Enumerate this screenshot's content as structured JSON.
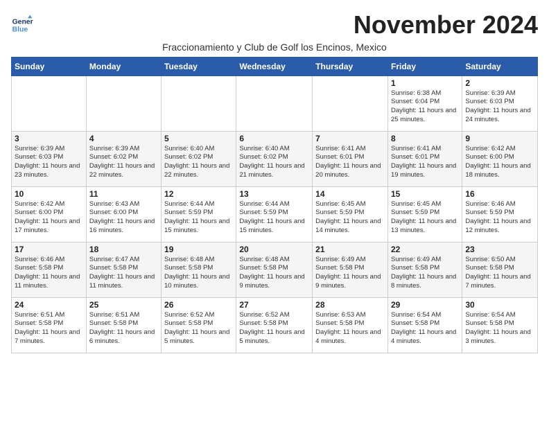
{
  "logo": {
    "line1": "General",
    "line2": "Blue"
  },
  "title": "November 2024",
  "subtitle": "Fraccionamiento y Club de Golf los Encinos, Mexico",
  "days_header": [
    "Sunday",
    "Monday",
    "Tuesday",
    "Wednesday",
    "Thursday",
    "Friday",
    "Saturday"
  ],
  "weeks": [
    [
      {
        "num": "",
        "info": ""
      },
      {
        "num": "",
        "info": ""
      },
      {
        "num": "",
        "info": ""
      },
      {
        "num": "",
        "info": ""
      },
      {
        "num": "",
        "info": ""
      },
      {
        "num": "1",
        "info": "Sunrise: 6:38 AM\nSunset: 6:04 PM\nDaylight: 11 hours and 25 minutes."
      },
      {
        "num": "2",
        "info": "Sunrise: 6:39 AM\nSunset: 6:03 PM\nDaylight: 11 hours and 24 minutes."
      }
    ],
    [
      {
        "num": "3",
        "info": "Sunrise: 6:39 AM\nSunset: 6:03 PM\nDaylight: 11 hours and 23 minutes."
      },
      {
        "num": "4",
        "info": "Sunrise: 6:39 AM\nSunset: 6:02 PM\nDaylight: 11 hours and 22 minutes."
      },
      {
        "num": "5",
        "info": "Sunrise: 6:40 AM\nSunset: 6:02 PM\nDaylight: 11 hours and 22 minutes."
      },
      {
        "num": "6",
        "info": "Sunrise: 6:40 AM\nSunset: 6:02 PM\nDaylight: 11 hours and 21 minutes."
      },
      {
        "num": "7",
        "info": "Sunrise: 6:41 AM\nSunset: 6:01 PM\nDaylight: 11 hours and 20 minutes."
      },
      {
        "num": "8",
        "info": "Sunrise: 6:41 AM\nSunset: 6:01 PM\nDaylight: 11 hours and 19 minutes."
      },
      {
        "num": "9",
        "info": "Sunrise: 6:42 AM\nSunset: 6:00 PM\nDaylight: 11 hours and 18 minutes."
      }
    ],
    [
      {
        "num": "10",
        "info": "Sunrise: 6:42 AM\nSunset: 6:00 PM\nDaylight: 11 hours and 17 minutes."
      },
      {
        "num": "11",
        "info": "Sunrise: 6:43 AM\nSunset: 6:00 PM\nDaylight: 11 hours and 16 minutes."
      },
      {
        "num": "12",
        "info": "Sunrise: 6:44 AM\nSunset: 5:59 PM\nDaylight: 11 hours and 15 minutes."
      },
      {
        "num": "13",
        "info": "Sunrise: 6:44 AM\nSunset: 5:59 PM\nDaylight: 11 hours and 15 minutes."
      },
      {
        "num": "14",
        "info": "Sunrise: 6:45 AM\nSunset: 5:59 PM\nDaylight: 11 hours and 14 minutes."
      },
      {
        "num": "15",
        "info": "Sunrise: 6:45 AM\nSunset: 5:59 PM\nDaylight: 11 hours and 13 minutes."
      },
      {
        "num": "16",
        "info": "Sunrise: 6:46 AM\nSunset: 5:59 PM\nDaylight: 11 hours and 12 minutes."
      }
    ],
    [
      {
        "num": "17",
        "info": "Sunrise: 6:46 AM\nSunset: 5:58 PM\nDaylight: 11 hours and 11 minutes."
      },
      {
        "num": "18",
        "info": "Sunrise: 6:47 AM\nSunset: 5:58 PM\nDaylight: 11 hours and 11 minutes."
      },
      {
        "num": "19",
        "info": "Sunrise: 6:48 AM\nSunset: 5:58 PM\nDaylight: 11 hours and 10 minutes."
      },
      {
        "num": "20",
        "info": "Sunrise: 6:48 AM\nSunset: 5:58 PM\nDaylight: 11 hours and 9 minutes."
      },
      {
        "num": "21",
        "info": "Sunrise: 6:49 AM\nSunset: 5:58 PM\nDaylight: 11 hours and 9 minutes."
      },
      {
        "num": "22",
        "info": "Sunrise: 6:49 AM\nSunset: 5:58 PM\nDaylight: 11 hours and 8 minutes."
      },
      {
        "num": "23",
        "info": "Sunrise: 6:50 AM\nSunset: 5:58 PM\nDaylight: 11 hours and 7 minutes."
      }
    ],
    [
      {
        "num": "24",
        "info": "Sunrise: 6:51 AM\nSunset: 5:58 PM\nDaylight: 11 hours and 7 minutes."
      },
      {
        "num": "25",
        "info": "Sunrise: 6:51 AM\nSunset: 5:58 PM\nDaylight: 11 hours and 6 minutes."
      },
      {
        "num": "26",
        "info": "Sunrise: 6:52 AM\nSunset: 5:58 PM\nDaylight: 11 hours and 5 minutes."
      },
      {
        "num": "27",
        "info": "Sunrise: 6:52 AM\nSunset: 5:58 PM\nDaylight: 11 hours and 5 minutes."
      },
      {
        "num": "28",
        "info": "Sunrise: 6:53 AM\nSunset: 5:58 PM\nDaylight: 11 hours and 4 minutes."
      },
      {
        "num": "29",
        "info": "Sunrise: 6:54 AM\nSunset: 5:58 PM\nDaylight: 11 hours and 4 minutes."
      },
      {
        "num": "30",
        "info": "Sunrise: 6:54 AM\nSunset: 5:58 PM\nDaylight: 11 hours and 3 minutes."
      }
    ]
  ]
}
